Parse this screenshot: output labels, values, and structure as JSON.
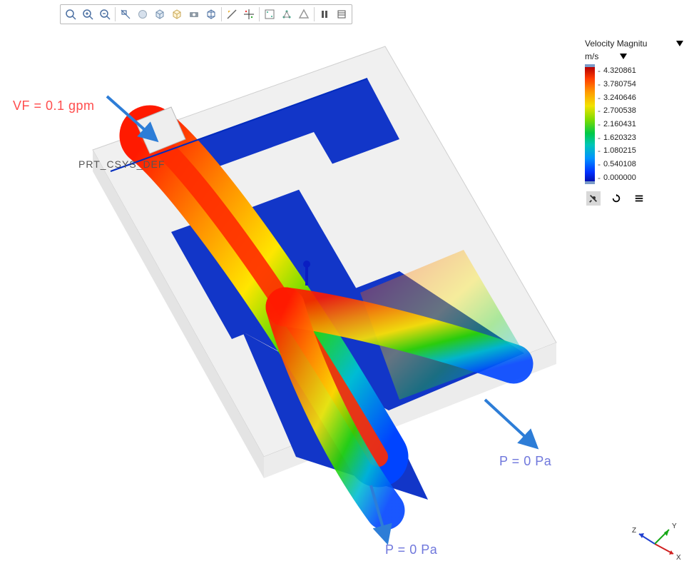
{
  "toolbar": {
    "icons": [
      "zoom-fit",
      "zoom-in",
      "zoom-out",
      "zoom-window",
      "spin",
      "view-cube",
      "saved-view",
      "camera",
      "perspective",
      "section",
      "probe",
      "streamline",
      "iso",
      "triangle",
      "pause",
      "legend"
    ]
  },
  "legend": {
    "title": "Velocity Magnitu",
    "units": "m/s",
    "ticks": [
      "4.320861",
      "3.780754",
      "3.240646",
      "2.700538",
      "2.160431",
      "1.620323",
      "1.080215",
      "0.540108",
      "0.000000"
    ],
    "buttons": {
      "pin": "pin-icon",
      "refresh": "refresh-icon",
      "menu": "menu-icon"
    }
  },
  "annotations": {
    "inlet_vf": "VF = 0.1 gpm",
    "csys": "PRT_CSYS_DEF",
    "outlet_a": "P = 0 Pa",
    "outlet_b": "P = 0 Pa"
  },
  "axes": {
    "x": "X",
    "y": "Y",
    "z": "Z"
  }
}
